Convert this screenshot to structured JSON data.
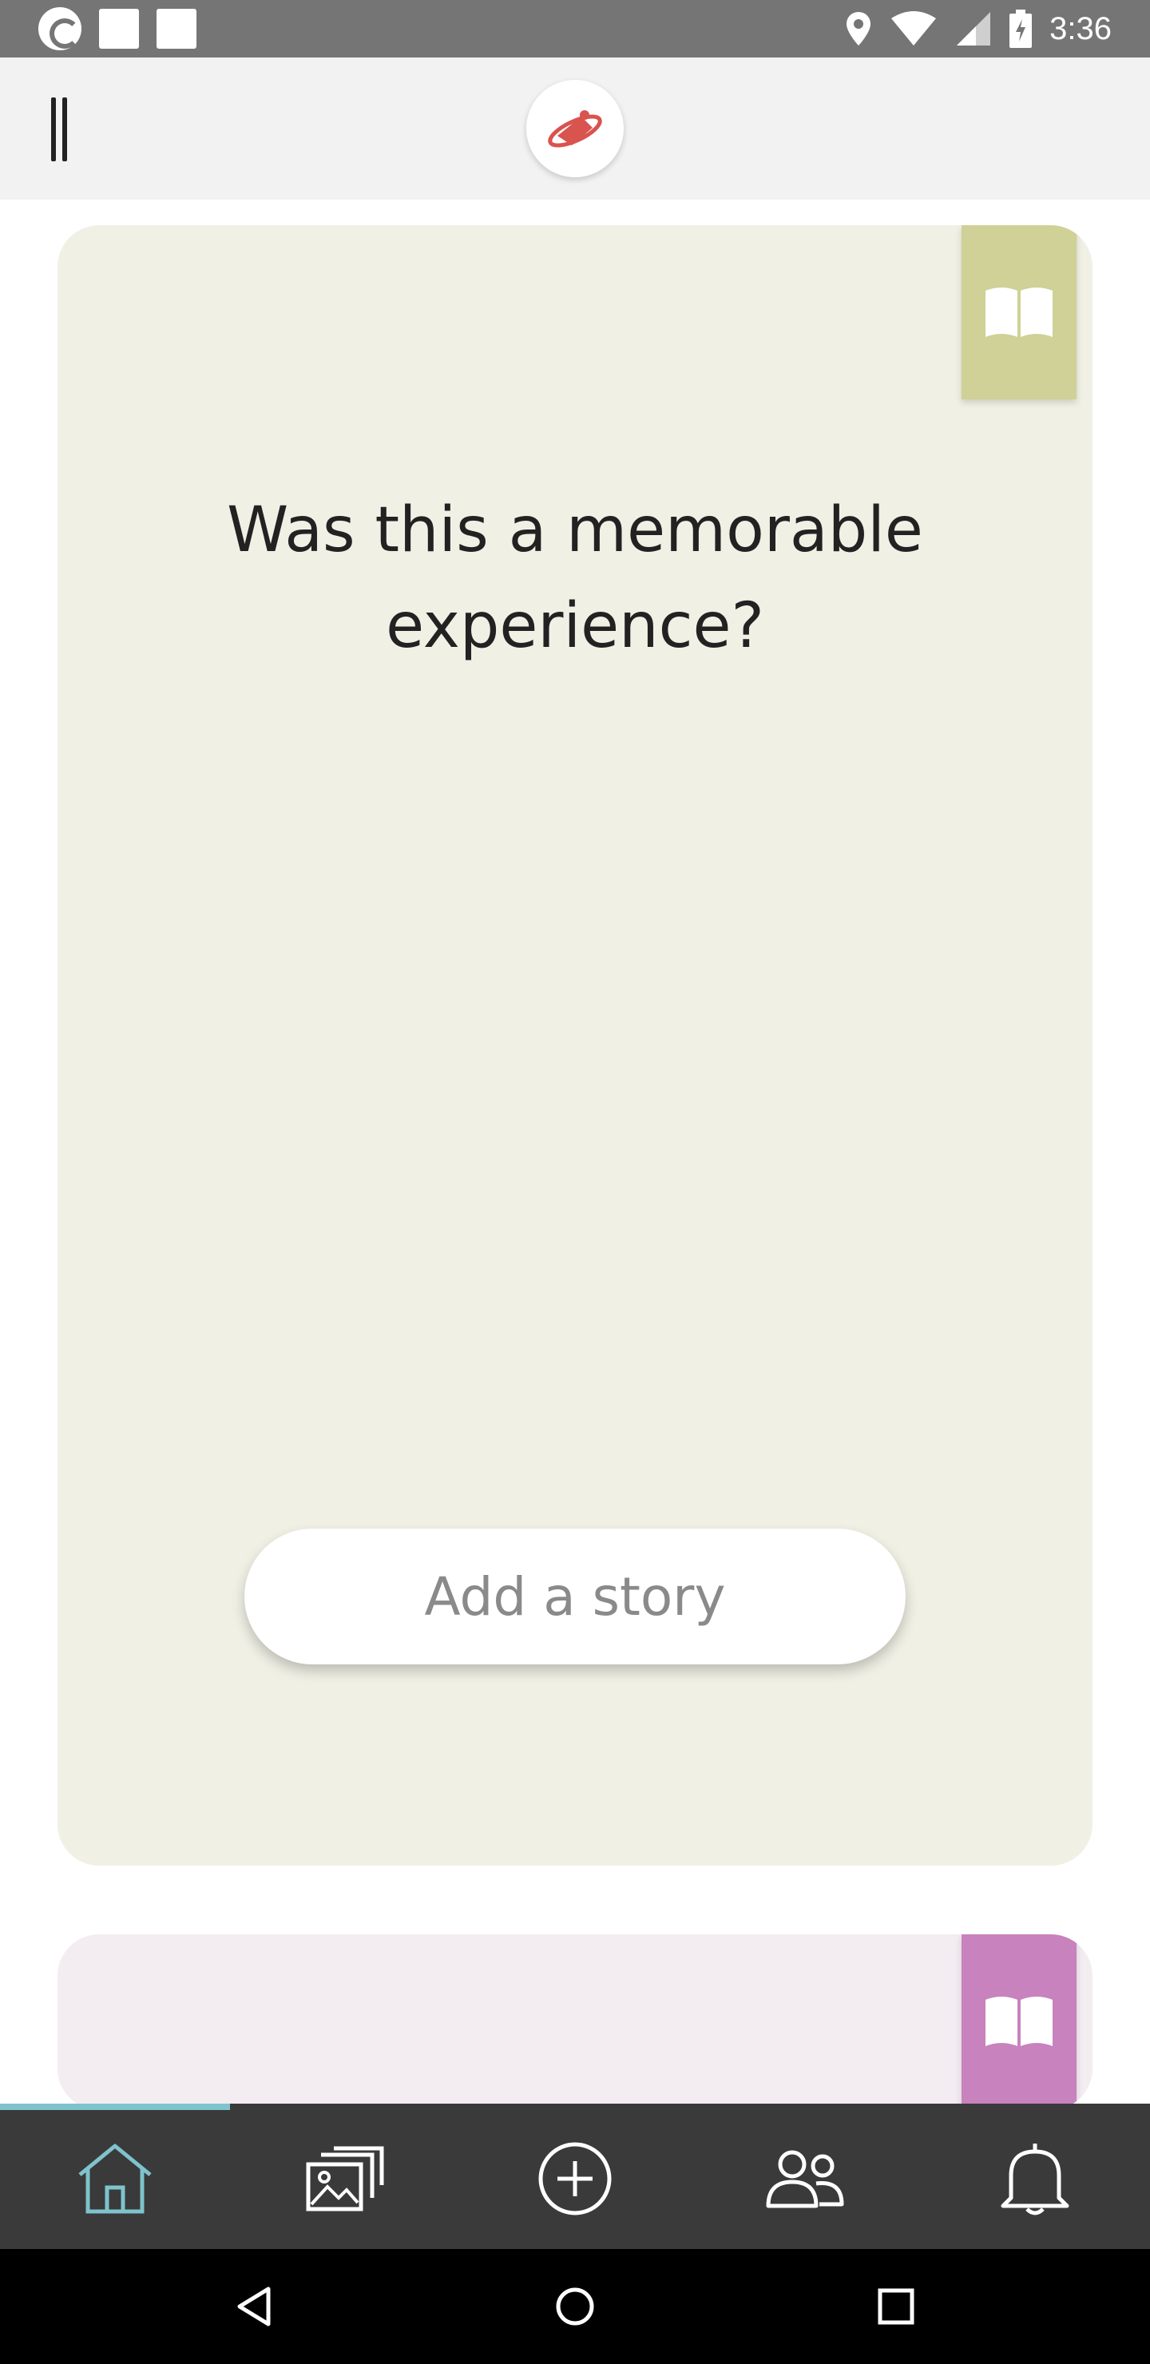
{
  "status_bar": {
    "time": "3:36"
  },
  "app_bar": {
    "menu_icon": "menu-icon",
    "logo_icon": "logo-icon"
  },
  "cards": [
    {
      "question": "Was this a memorable experience?",
      "button_label": "Add a story",
      "bookmark_icon": "open-book-icon",
      "background_color": "#f0f0e5",
      "tab_color": "#cfd196"
    },
    {
      "bookmark_icon": "open-book-icon",
      "background_color": "#f3ecf1",
      "tab_color": "#c882be"
    }
  ],
  "bottom_nav": {
    "items": [
      "home-icon",
      "gallery-icon",
      "add-icon",
      "people-icon",
      "bell-icon"
    ],
    "active_index": 0,
    "active_color": "#7fc3cc"
  },
  "system_nav": {
    "buttons": [
      "back-icon",
      "home-circle-icon",
      "recents-icon"
    ]
  }
}
